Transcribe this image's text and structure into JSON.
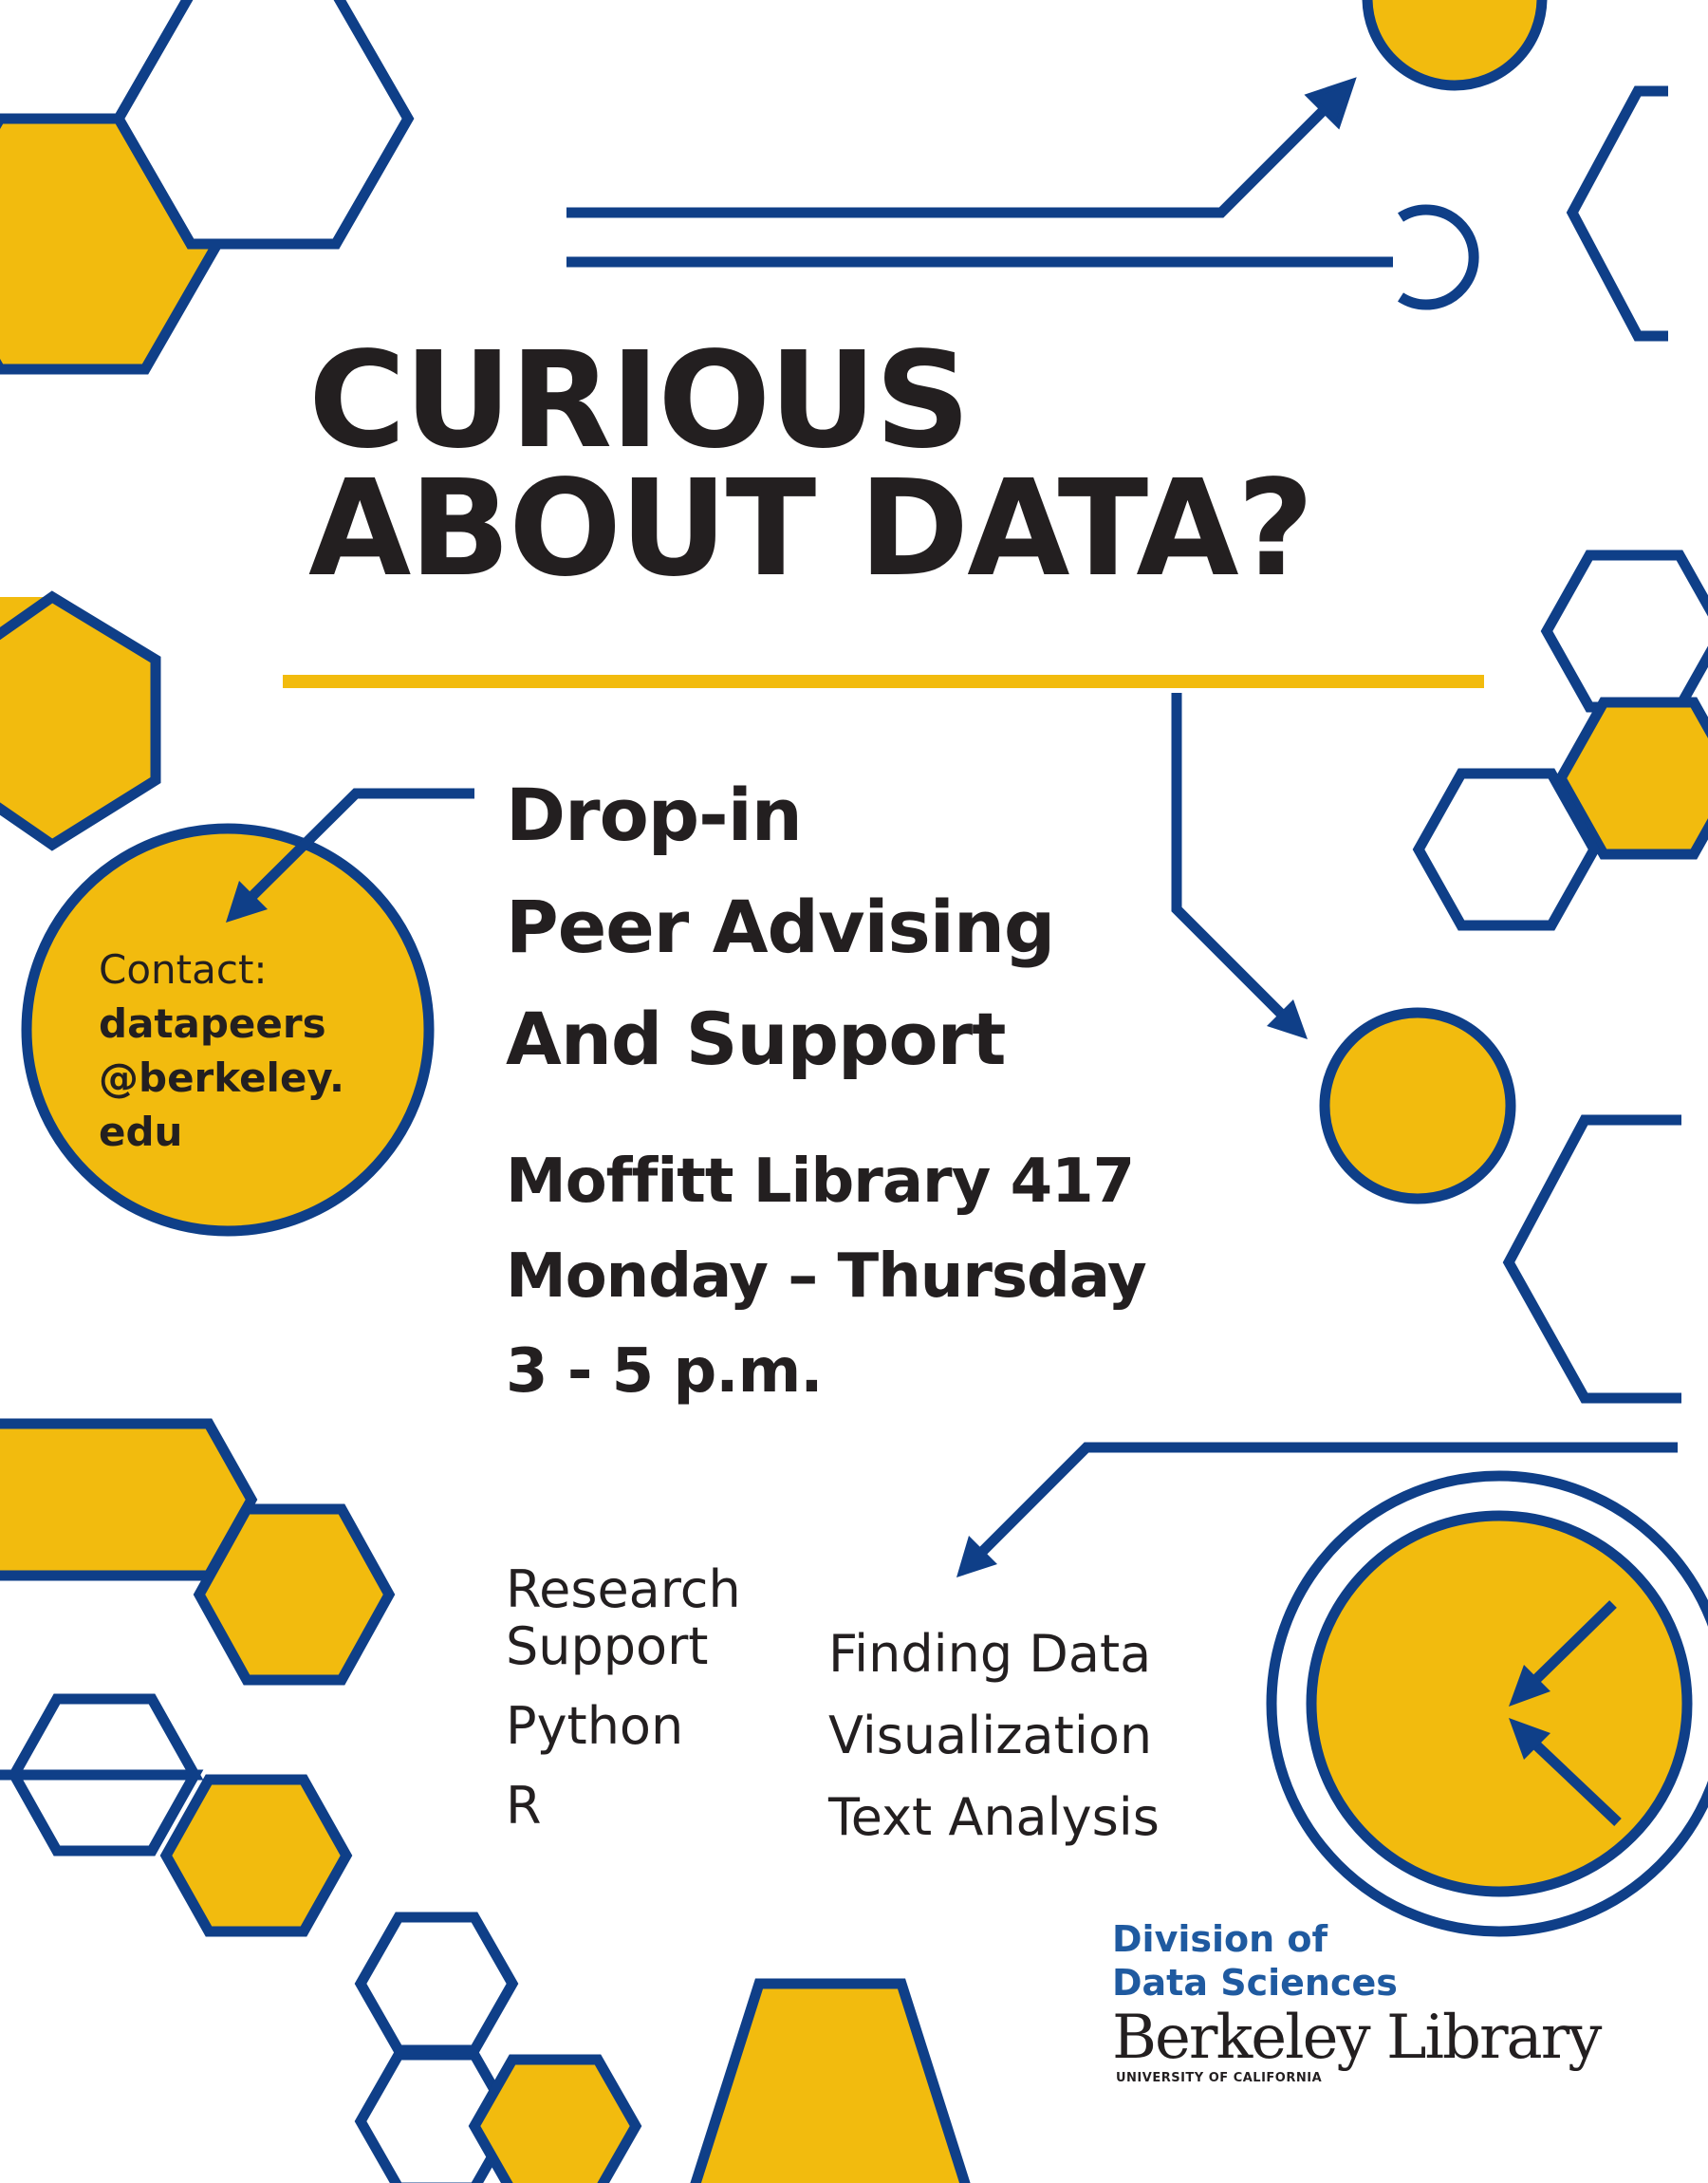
{
  "colors": {
    "navy": "#0f3f88",
    "gold": "#f2bb0e",
    "text": "#231f20",
    "division_blue": "#1f5aa0"
  },
  "headline": {
    "line1": "CURIOUS",
    "line2": "ABOUT DATA?"
  },
  "subhead": {
    "line1": "Drop-in",
    "line2": "Peer Advising",
    "line3": "And Support"
  },
  "details": {
    "location": "Moffitt  Library 417",
    "days": "Monday – Thursday",
    "time": "3 - 5 p.m."
  },
  "contact": {
    "label": "Contact:",
    "line1": "datapeers",
    "line2": "@berkeley.",
    "line3": "edu"
  },
  "topics": {
    "left": [
      "Research",
      "Support",
      "Python",
      "R"
    ],
    "right": [
      "Finding Data",
      "Visualization",
      "Text Analysis"
    ]
  },
  "sponsor": {
    "division_line1": "Division of",
    "division_line2": "Data Sciences",
    "library": "Berkeley Library",
    "university": "UNIVERSITY OF CALIFORNIA"
  },
  "decor": {
    "icons": [
      "hexagon-cluster-icon",
      "circuit-arrow-icon",
      "target-icon"
    ]
  }
}
